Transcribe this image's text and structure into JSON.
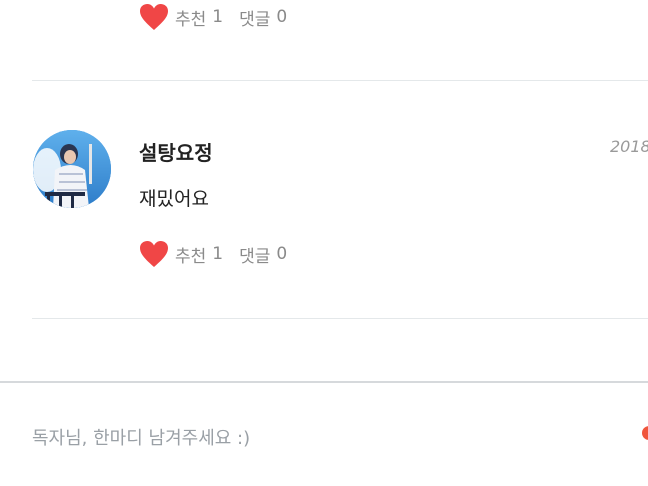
{
  "comments": [
    {
      "reactions": {
        "like_label": "추천",
        "like_count": "1",
        "reply_label": "댓글",
        "reply_count": "0"
      }
    },
    {
      "author": "설탕요정",
      "date": "2018",
      "text": "재밌어요",
      "reactions": {
        "like_label": "추천",
        "like_count": "1",
        "reply_label": "댓글",
        "reply_count": "0"
      }
    }
  ],
  "input": {
    "placeholder": "독자님, 한마디 남겨주세요 :)"
  },
  "colors": {
    "heart": "#f04646",
    "divider": "#e4e8ea",
    "muted_text": "#8a8a8a",
    "send_accent": "#f0553c"
  },
  "icons": {
    "like": "heart-icon",
    "send": "send-icon"
  }
}
